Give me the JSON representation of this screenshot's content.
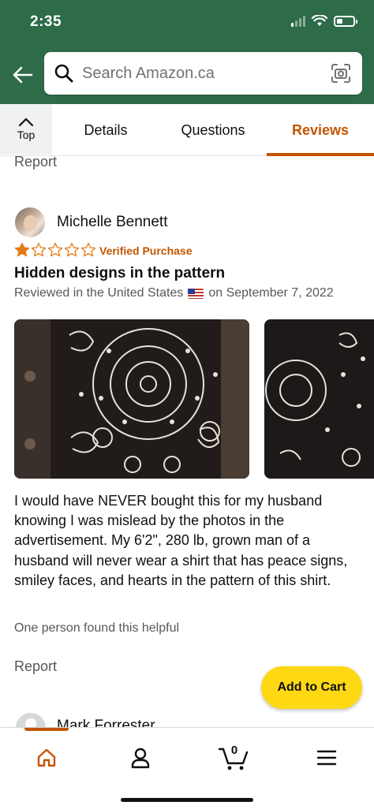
{
  "status_bar": {
    "time": "2:35"
  },
  "search": {
    "placeholder": "Search Amazon.ca"
  },
  "tabs": {
    "top_label": "Top",
    "items": [
      {
        "label": "Details",
        "active": false
      },
      {
        "label": "Questions",
        "active": false
      },
      {
        "label": "Reviews",
        "active": true
      }
    ]
  },
  "previous_review": {
    "report_label": "Report"
  },
  "review": {
    "reviewer": "Michelle Bennett",
    "rating": 1,
    "max_rating": 5,
    "badge": "Verified Purchase",
    "title": "Hidden designs in the pattern",
    "meta_prefix": "Reviewed in the United States",
    "meta_suffix": "on September 7, 2022",
    "body": "I would have NEVER bought this for my husband knowing I was mislead by the photos in the advertisement. My 6'2\", 280 lb, grown man of a husband will never wear a shirt that has peace signs, smiley faces, and hearts in the pattern of this shirt.",
    "helpful": "One person found this helpful",
    "report_label": "Report"
  },
  "next_review": {
    "reviewer": "Mark Forrester"
  },
  "add_to_cart": {
    "label": "Add to Cart"
  },
  "bottom_nav": {
    "cart_count": "0",
    "active": "home"
  },
  "colors": {
    "header": "#2e6b49",
    "accent": "#c45500",
    "button": "#ffd814",
    "star": "#e47911"
  }
}
